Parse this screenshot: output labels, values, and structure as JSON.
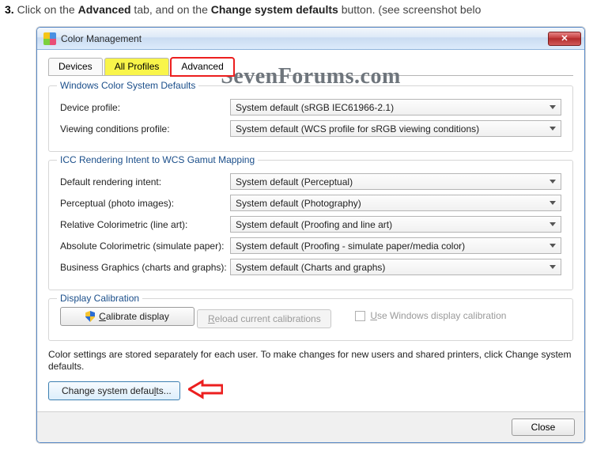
{
  "instruction": {
    "num": "3.",
    "prefix": " Click on the ",
    "bold1": "Advanced",
    "mid": " tab, and on the ",
    "bold2": "Change system defaults",
    "suffix": " button. (see screenshot belo"
  },
  "window": {
    "title": "Color Management",
    "watermark": "SevenForums.com"
  },
  "tabs": {
    "t0": "Devices",
    "t1": "All Profiles",
    "t2": "Advanced"
  },
  "group1": {
    "title": "Windows Color System Defaults",
    "rows": [
      {
        "label": "Device profile:",
        "value": "System default (sRGB IEC61966-2.1)"
      },
      {
        "label": "Viewing conditions profile:",
        "value": "System default (WCS profile for sRGB viewing conditions)"
      }
    ]
  },
  "group2": {
    "title": "ICC Rendering Intent to WCS Gamut Mapping",
    "rows": [
      {
        "label": "Default rendering intent:",
        "value": "System default (Perceptual)"
      },
      {
        "label": "Perceptual (photo images):",
        "value": "System default (Photography)"
      },
      {
        "label": "Relative Colorimetric (line art):",
        "value": "System default (Proofing and line art)"
      },
      {
        "label": "Absolute Colorimetric (simulate paper):",
        "value": "System default (Proofing - simulate paper/media color)"
      },
      {
        "label": "Business Graphics (charts and graphs):",
        "value": "System default (Charts and graphs)"
      }
    ]
  },
  "group3": {
    "title": "Display Calibration",
    "calibrate_btn": "Calibrate display",
    "reload_btn": "Reload current calibrations",
    "use_windows_cal": "Use Windows display calibration"
  },
  "note": "Color settings are stored separately for each user. To make changes for new users and shared printers, click Change system defaults.",
  "change_btn": "Change system defaults...",
  "footer_close": "Close"
}
